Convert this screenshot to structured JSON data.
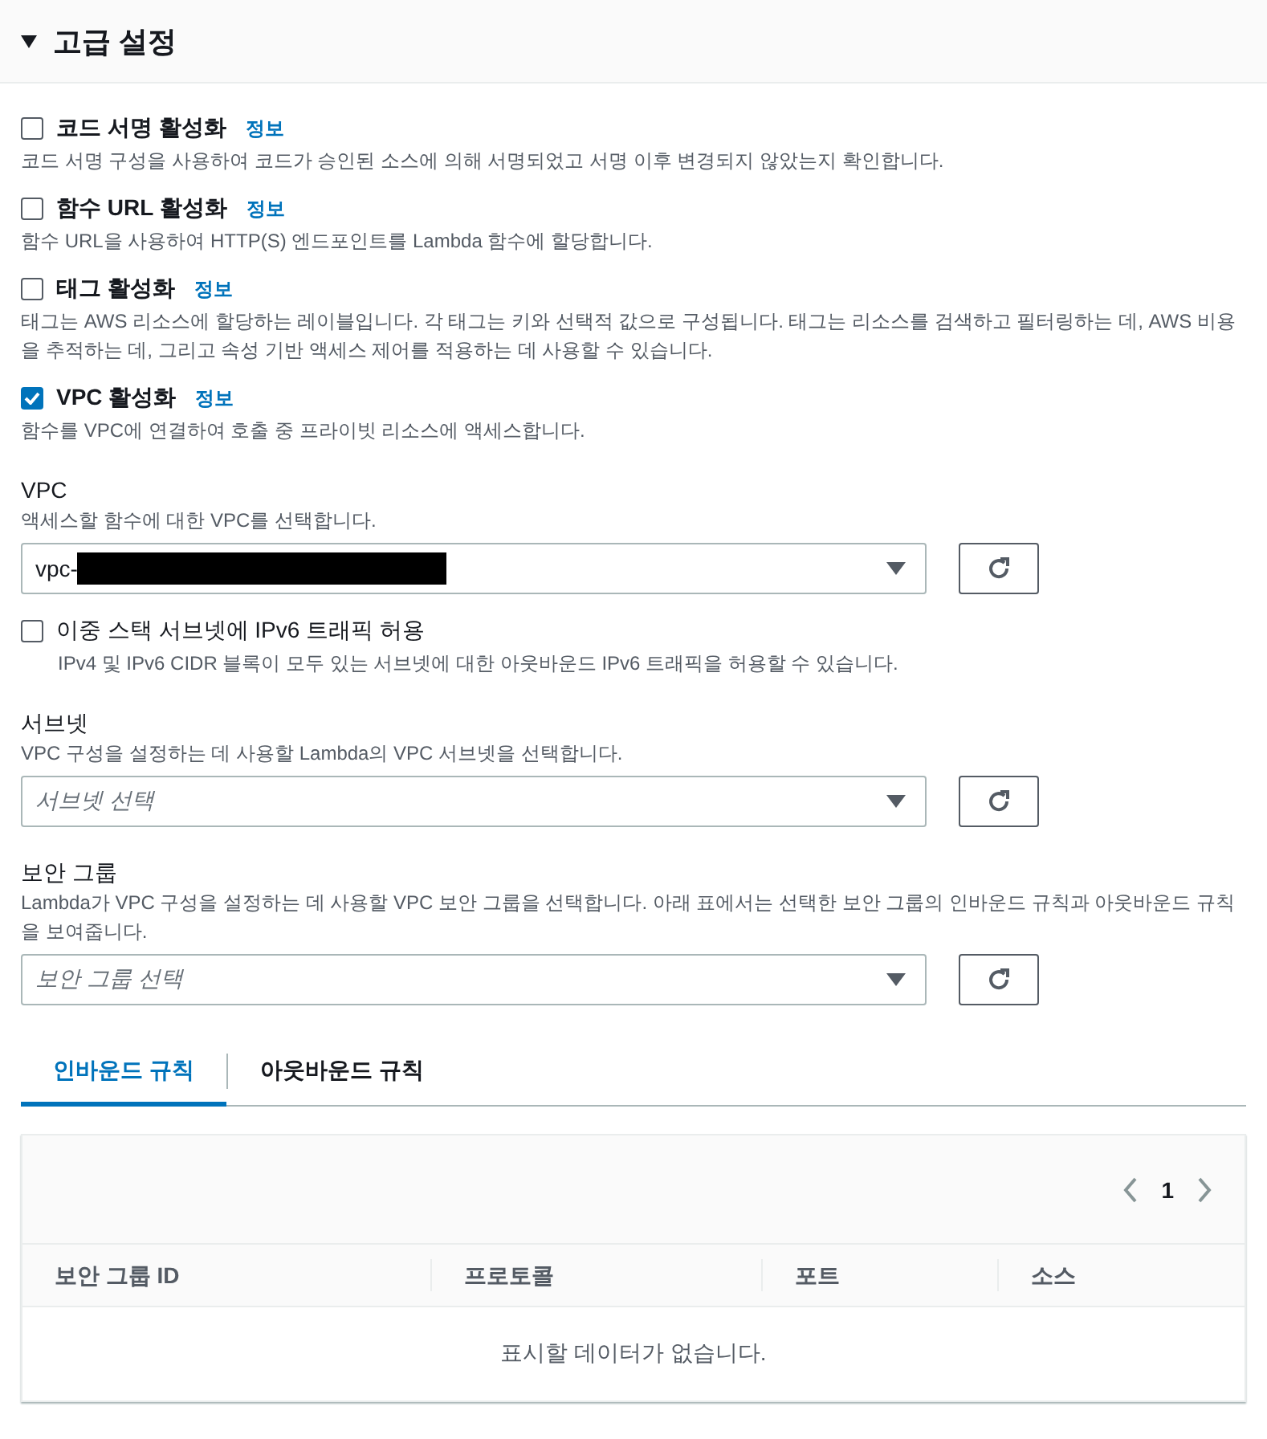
{
  "section": {
    "title": "고급 설정",
    "expanded": true
  },
  "options": [
    {
      "label": "코드 서명 활성화",
      "info": "정보",
      "description": "코드 서명 구성을 사용하여 코드가 승인된 소스에 의해 서명되었고 서명 이후 변경되지 않았는지 확인합니다.",
      "checked": false
    },
    {
      "label": "함수 URL 활성화",
      "info": "정보",
      "description": "함수 URL을 사용하여 HTTP(S) 엔드포인트를 Lambda 함수에 할당합니다.",
      "checked": false
    },
    {
      "label": "태그 활성화",
      "info": "정보",
      "description": "태그는 AWS 리소스에 할당하는 레이블입니다. 각 태그는 키와 선택적 값으로 구성됩니다. 태그는 리소스를 검색하고 필터링하는 데, AWS 비용을 추적하는 데, 그리고 속성 기반 액세스 제어를 적용하는 데 사용할 수 있습니다.",
      "checked": false
    },
    {
      "label": "VPC 활성화",
      "info": "정보",
      "description": "함수를 VPC에 연결하여 호출 중 프라이빗 리소스에 액세스합니다.",
      "checked": true
    }
  ],
  "vpc": {
    "label": "VPC",
    "description": "액세스할 함수에 대한 VPC를 선택합니다.",
    "value": "vpc-"
  },
  "ipv6": {
    "label": "이중 스택 서브넷에 IPv6 트래픽 허용",
    "description": "IPv4 및 IPv6 CIDR 블록이 모두 있는 서브넷에 대한 아웃바운드 IPv6 트래픽을 허용할 수 있습니다.",
    "checked": false
  },
  "subnet": {
    "label": "서브넷",
    "description": "VPC 구성을 설정하는 데 사용할 Lambda의 VPC 서브넷을 선택합니다.",
    "placeholder": "서브넷 선택"
  },
  "security_group": {
    "label": "보안 그룹",
    "description": "Lambda가 VPC 구성을 설정하는 데 사용할 VPC 보안 그룹을 선택합니다. 아래 표에서는 선택한 보안 그룹의 인바운드 규칙과 아웃바운드 규칙을 보여줍니다.",
    "placeholder": "보안 그룹 선택"
  },
  "tabs": [
    {
      "label": "인바운드 규칙",
      "selected": true
    },
    {
      "label": "아웃바운드 규칙",
      "selected": false
    }
  ],
  "table": {
    "page": "1",
    "columns": [
      "보안 그룹 ID",
      "프로토콜",
      "포트",
      "소스"
    ],
    "empty_text": "표시할 데이터가 없습니다."
  }
}
